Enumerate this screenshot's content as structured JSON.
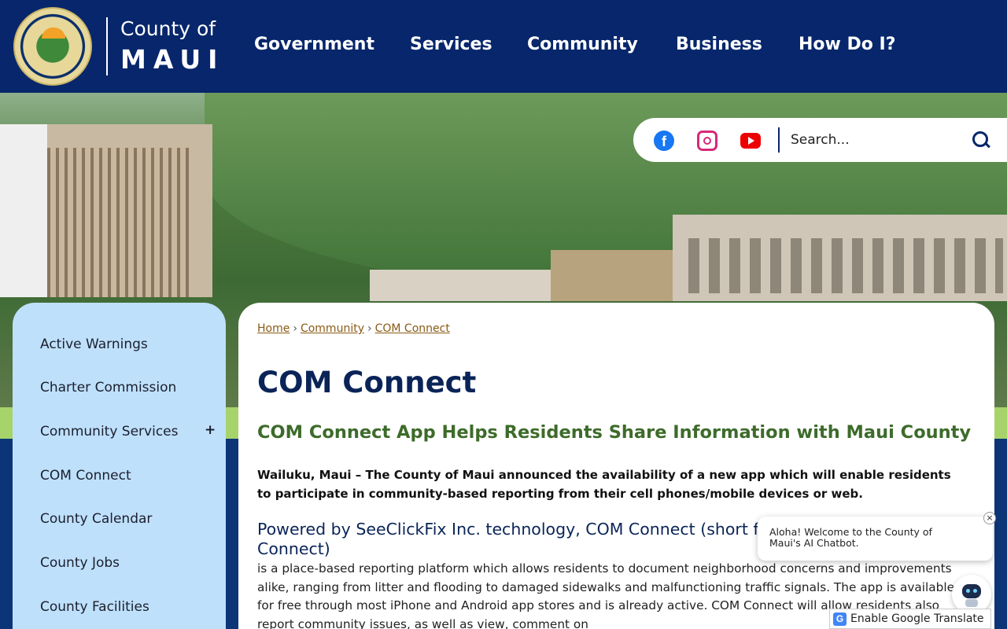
{
  "header": {
    "logo_line1": "County of",
    "logo_line2": "MAUI",
    "seal_icon": "county-seal"
  },
  "nav": [
    {
      "label": "Government"
    },
    {
      "label": "Services"
    },
    {
      "label": "Community"
    },
    {
      "label": "Business"
    },
    {
      "label": "How Do I?"
    }
  ],
  "social": {
    "facebook_glyph": "f",
    "icons": [
      "facebook-icon",
      "instagram-icon",
      "youtube-icon"
    ]
  },
  "search": {
    "placeholder": "Search..."
  },
  "sidebar": {
    "items": [
      {
        "label": "Active Warnings"
      },
      {
        "label": "Charter Commission"
      },
      {
        "label": "Community Services",
        "expand": "+"
      },
      {
        "label": "COM Connect"
      },
      {
        "label": "County Calendar"
      },
      {
        "label": "County Jobs"
      },
      {
        "label": "County Facilities"
      }
    ]
  },
  "breadcrumb": {
    "items": [
      "Home",
      "Community",
      "COM Connect"
    ],
    "separator": "›"
  },
  "main": {
    "title": "COM Connect",
    "subhead": "COM Connect App Helps Residents Share Information with Maui County",
    "lede": "Wailuku, Maui – The County of Maui announced the availability of a new app which will enable residents to participate in community-based reporting from their cell phones/mobile devices or web.",
    "h3": "Powered by SeeClickFix Inc. technology,  COM Connect (short for County of Maui Connect)",
    "body": "is a place-based reporting platform which allows residents to document neighborhood concerns and improvements alike, ranging from litter and flooding to damaged sidewalks and malfunctioning traffic signals. The app is available for free through most iPhone and Android app stores and is already active. COM Connect will allow residents also report community issues, as well as view, comment on"
  },
  "chatbot": {
    "message": "Aloha! Welcome to the County of Maui's AI Chatbot.",
    "close": "×"
  },
  "translate": {
    "label": "Enable Google Translate",
    "glyph": "G"
  },
  "colors": {
    "header_bg": "#07266b",
    "sidebar_bg": "#bfe0fb",
    "title": "#0a2458",
    "subhead": "#3d6b2a",
    "link": "#8a5a14",
    "accent_green": "#a6d46a"
  }
}
